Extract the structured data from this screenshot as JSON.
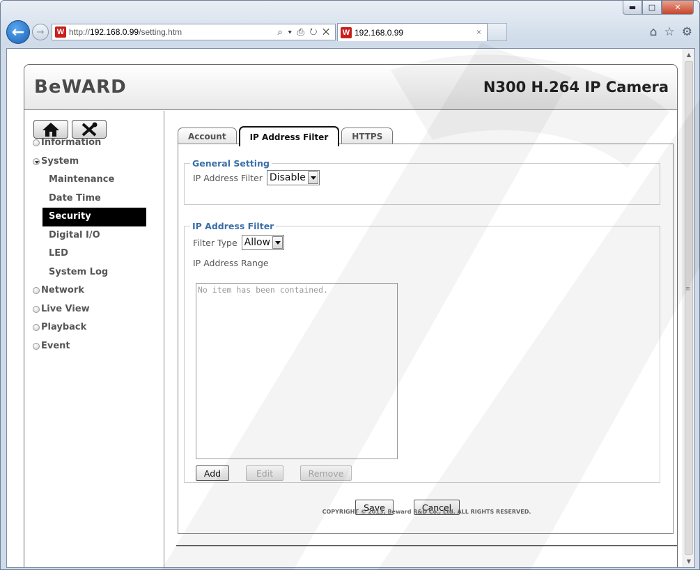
{
  "browser": {
    "url_prefix": "http://",
    "url_host": "192.168.0.99",
    "url_path": "/setting.htm",
    "addr_tools": "⌕ ▾ ⎙ ↻ ✕",
    "tab_title": "192.168.0.99",
    "tab_close": "×"
  },
  "camera": {
    "logo": "BeWARD",
    "product": "N300 H.264 IP Camera",
    "menu": {
      "information": "Information",
      "system": "System",
      "maintenance": "Maintenance",
      "date_time": "Date Time",
      "security": "Security",
      "digital_io": "Digital I/O",
      "led": "LED",
      "system_log": "System Log",
      "network": "Network",
      "live_view": "Live View",
      "playback": "Playback",
      "event": "Event"
    },
    "tabs": {
      "account": "Account",
      "ip_filter": "IP Address Filter",
      "https": "HTTPS"
    },
    "general": {
      "legend": "General Setting",
      "label": "IP Address Filter",
      "value": "Disable"
    },
    "filter": {
      "legend": "IP Address Filter",
      "type_label": "Filter Type",
      "type_value": "Allow",
      "range_label": "IP Address Range",
      "empty_text": "No item has been contained.",
      "add": "Add",
      "edit": "Edit",
      "remove": "Remove"
    },
    "save": "Save",
    "cancel": "Cancel",
    "copyright": "COPYRIGHT © 2013, Beward R&D Co., Ltd. ALL RIGHTS RESERVED."
  },
  "colors": {
    "accent": "#3a6ea8",
    "selected_menu_bg": "#000000"
  }
}
